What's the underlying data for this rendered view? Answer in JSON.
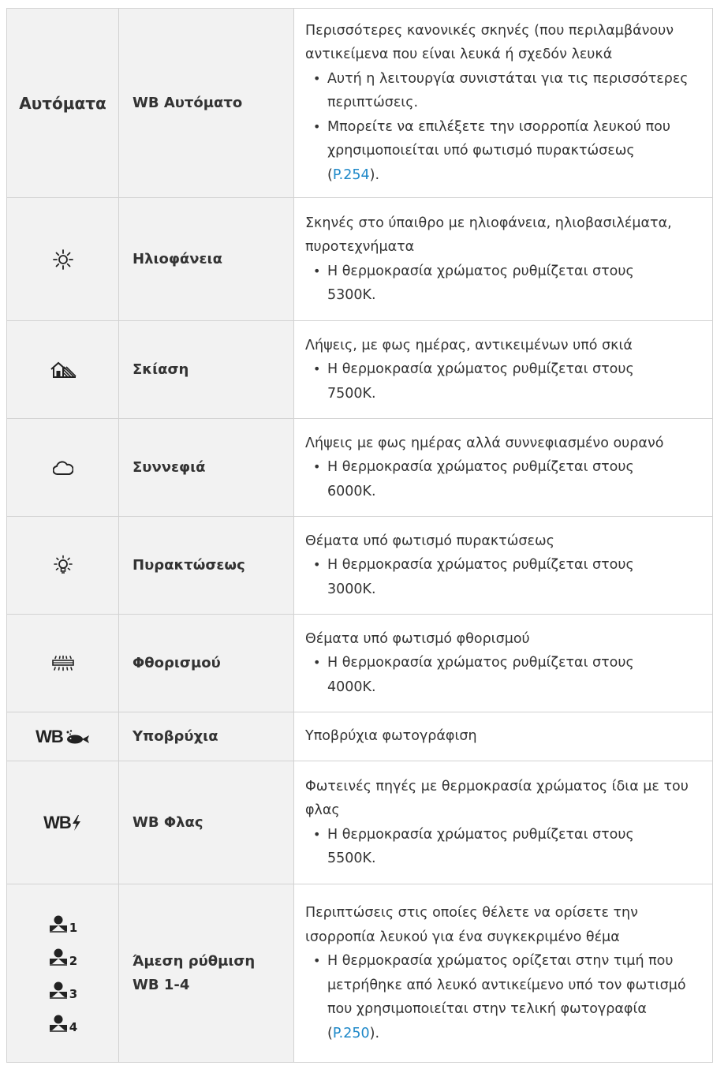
{
  "rows": [
    {
      "mode_label": "Αυτόματα",
      "name": "WB Αυτόματο",
      "desc_lines": [
        "Περισσότερες κανονικές σκηνές (που περιλαμβάνουν αντικείμενα που είναι λευκά ή σχεδόν λευκά"
      ],
      "bullets": [
        "Αυτή η λειτουργία συνιστάται για τις περισσότερες περιπτώσεις."
      ],
      "bullet_link": {
        "pre": "Μπορείτε να επιλέξετε την ισορροπία λευκού που χρησιμοποιείται υπό φωτισμό πυρακτώσεως (",
        "link": "P.254",
        "post": ")."
      }
    },
    {
      "icon": "sunny-icon",
      "name": "Ηλιοφάνεια",
      "desc_lines": [
        "Σκηνές στο ύπαιθρο με ηλιοφάνεια, ηλιοβασιλέματα, πυροτεχνήματα"
      ],
      "bullets": [
        "Η θερμοκρασία χρώματος ρυθμίζεται στους 5300K."
      ]
    },
    {
      "icon": "shade-icon",
      "name": "Σκίαση",
      "desc_lines": [
        "Λήψεις, με φως ημέρας, αντικειμένων υπό σκιά"
      ],
      "bullets": [
        "Η θερμοκρασία χρώματος ρυθμίζεται στους 7500K."
      ]
    },
    {
      "icon": "cloudy-icon",
      "name": "Συννεφιά",
      "desc_lines": [
        "Λήψεις με φως ημέρας αλλά συννεφιασμένο ουρανό"
      ],
      "bullets": [
        "Η θερμοκρασία χρώματος ρυθμίζεται στους 6000K."
      ]
    },
    {
      "icon": "incandescent-icon",
      "name": "Πυρακτώσεως",
      "desc_lines": [
        "Θέματα υπό φωτισμό πυρακτώσεως"
      ],
      "bullets": [
        "Η θερμοκρασία χρώματος ρυθμίζεται στους 3000K."
      ]
    },
    {
      "icon": "fluorescent-icon",
      "name": "Φθορισμού",
      "desc_lines": [
        "Θέματα υπό φωτισμό φθορισμού"
      ],
      "bullets": [
        "Η θερμοκρασία χρώματος ρυθμίζεται στους 4000K."
      ]
    },
    {
      "icon": "underwater-icon",
      "icon_text": "WB",
      "name": "Υποβρύχια",
      "desc_lines": [
        "Υποβρύχια φωτογράφιση"
      ],
      "bullets": []
    },
    {
      "icon": "flash-icon",
      "icon_text": "WB",
      "name": "WB Φλας",
      "desc_lines": [
        "Φωτεινές πηγές με θερμοκρασία χρώματος ίδια με του φλας"
      ],
      "bullets": [
        "Η θερμοκρασία χρώματος ρυθμίζεται στους 5500K."
      ]
    },
    {
      "icon": "one-touch-wb-icon",
      "icon_subs": [
        "1",
        "2",
        "3",
        "4"
      ],
      "name": "Άμεση ρύθμιση WB 1-4",
      "desc_lines": [
        "Περιπτώσεις στις οποίες θέλετε να ορίσετε την ισορροπία λευκού για ένα συγκεκριμένο θέμα"
      ],
      "bullet_link": {
        "pre": "Η θερμοκρασία χρώματος ορίζεται στην τιμή που μετρήθηκε από λευκό αντικείμενο υπό τον φωτισμό που χρησιμοποιείται στην τελική φωτογραφία (",
        "link": "P.250",
        "post": ")."
      }
    }
  ]
}
